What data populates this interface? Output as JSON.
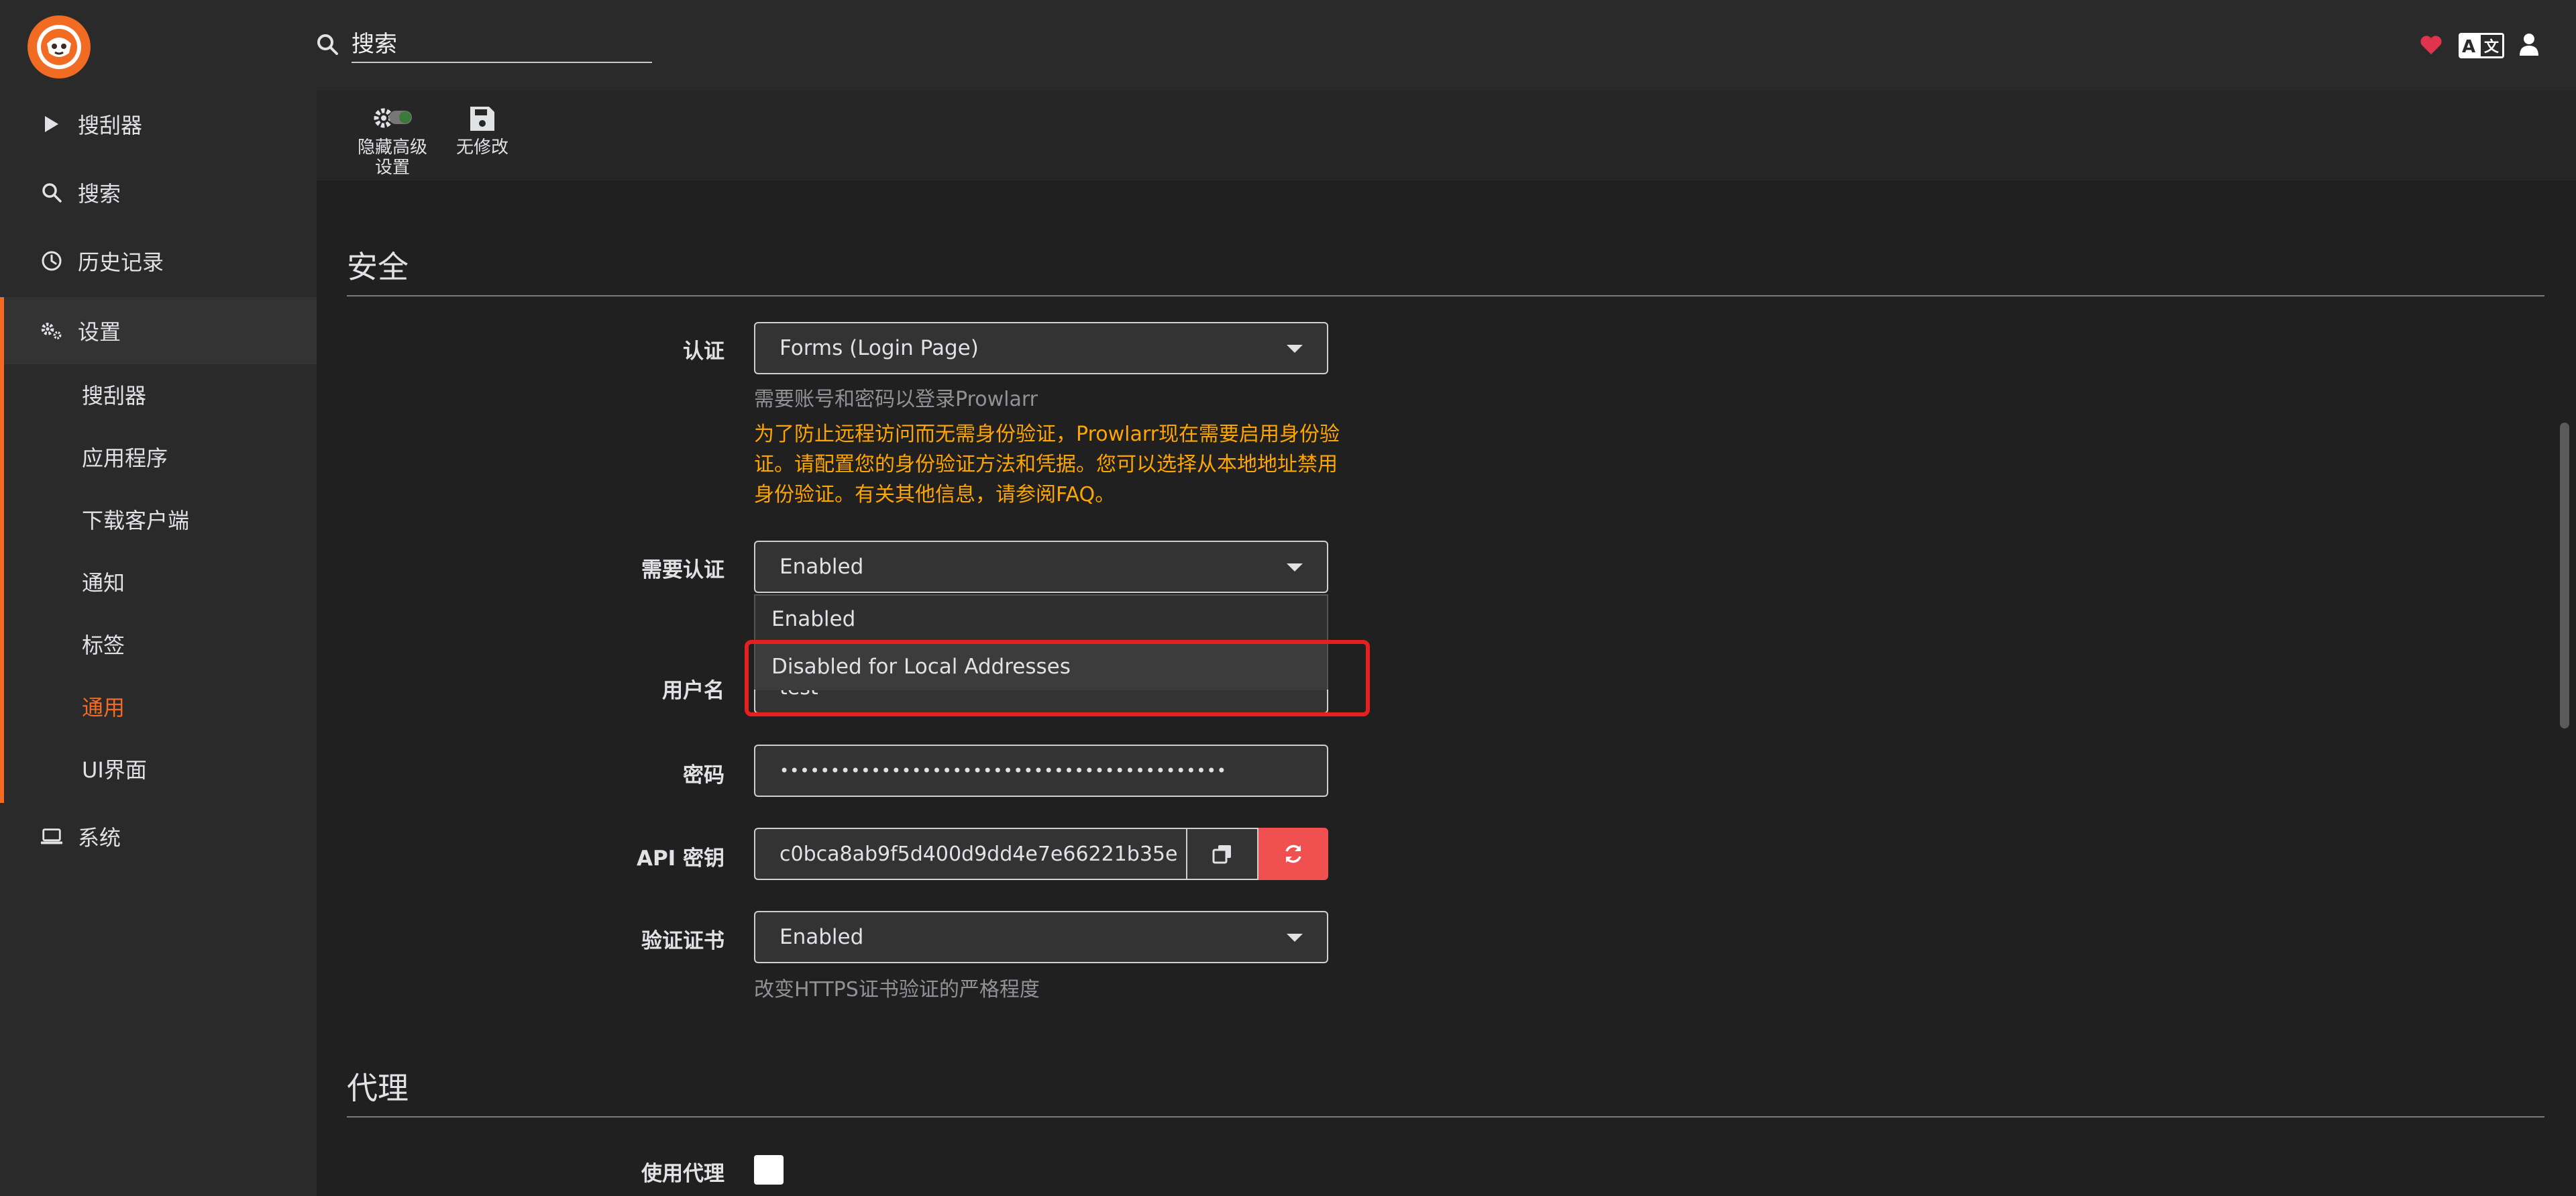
{
  "header": {
    "search_placeholder": "搜索"
  },
  "sidebar": {
    "items": [
      {
        "label": "搜刮器",
        "icon": "play-icon"
      },
      {
        "label": "搜索",
        "icon": "search-icon"
      },
      {
        "label": "历史记录",
        "icon": "clock-icon"
      },
      {
        "label": "设置",
        "icon": "gears-icon"
      },
      {
        "label": "系统",
        "icon": "laptop-icon"
      }
    ],
    "settings_sub": [
      "搜刮器",
      "应用程序",
      "下载客户端",
      "通知",
      "标签",
      "通用",
      "UI界面"
    ],
    "active_sub": "通用"
  },
  "toolbar": {
    "advanced_label": "隐藏高级设置",
    "advanced_line1": "隐藏高级",
    "advanced_line2": "设置",
    "save_label": "无修改"
  },
  "security": {
    "title": "安全",
    "auth_label": "认证",
    "auth_value": "Forms (Login Page)",
    "auth_help": "需要账号和密码以登录Prowlarr",
    "auth_warning": "为了防止远程访问而无需身份验证，Prowlarr现在需要启用身份验证。请配置您的身份验证方法和凭据。您可以选择从本地地址禁用身份验证。有关其他信息，请参阅FAQ。",
    "auth_required_label": "需要认证",
    "auth_required_value": "Enabled",
    "auth_required_options": [
      "Enabled",
      "Disabled for Local Addresses"
    ],
    "username_label": "用户名",
    "username_value": "test",
    "password_label": "密码",
    "password_value": "••••••••••••••••••••••••••••••••••••••••••••",
    "api_key_label": "API 密钥",
    "api_key_value": "c0bca8ab9f5d400d9dd4e7e66221b35e",
    "cert_label": "验证证书",
    "cert_value": "Enabled",
    "cert_help": "改变HTTPS证书验证的严格程度"
  },
  "proxy": {
    "title": "代理",
    "use_proxy_label": "使用代理"
  },
  "colors": {
    "accent": "#f26b22",
    "warning": "#ffa500",
    "danger": "#f05050",
    "highlight": "#e62020"
  }
}
